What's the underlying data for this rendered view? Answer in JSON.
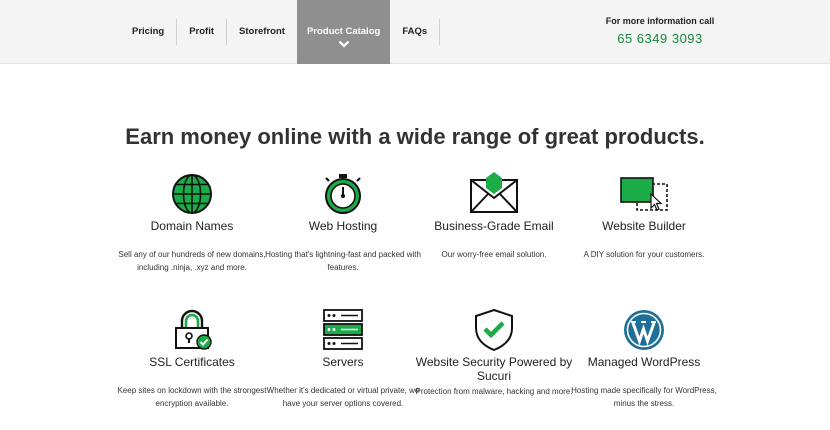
{
  "header": {
    "nav": [
      {
        "label": "Pricing"
      },
      {
        "label": "Profit"
      },
      {
        "label": "Storefront"
      },
      {
        "label": "Product Catalog",
        "active": true
      },
      {
        "label": "FAQs"
      }
    ],
    "contact_label": "For more information call",
    "contact_phone": "65 6349 3093"
  },
  "headline": "Earn money online with a wide range of great products.",
  "products": [
    {
      "title": "Domain Names",
      "desc": "Sell any of our hundreds of new domains, including .ninja, .xyz and more.",
      "icon": "globe-icon"
    },
    {
      "title": "Web Hosting",
      "desc": "Hosting that's lightning-fast and packed with features.",
      "icon": "stopwatch-icon"
    },
    {
      "title": "Business-Grade Email",
      "desc": "Our worry-free email solution.",
      "icon": "envelope-icon"
    },
    {
      "title": "Website Builder",
      "desc": "A DIY solution for your customers.",
      "icon": "website-builder-icon"
    },
    {
      "title": "SSL Certificates",
      "desc": "Keep sites on lockdown with the strongest encryption available.",
      "icon": "padlock-icon"
    },
    {
      "title": "Servers",
      "desc": "Whether it's dedicated or virtual private, we have your server options covered.",
      "icon": "server-rack-icon"
    },
    {
      "title": "Website Security Powered by Sucuri",
      "desc": "Protection from malware, hacking and more.",
      "icon": "shield-check-icon"
    },
    {
      "title": "Managed WordPress",
      "desc": "Hosting made specifically for WordPress, minus the stress.",
      "icon": "wordpress-icon"
    }
  ],
  "colors": {
    "accent_green": "#1bab48",
    "phone_green": "#168a3e",
    "nav_active_bg": "#8f8f8f",
    "header_bg": "#f4f4f5"
  }
}
